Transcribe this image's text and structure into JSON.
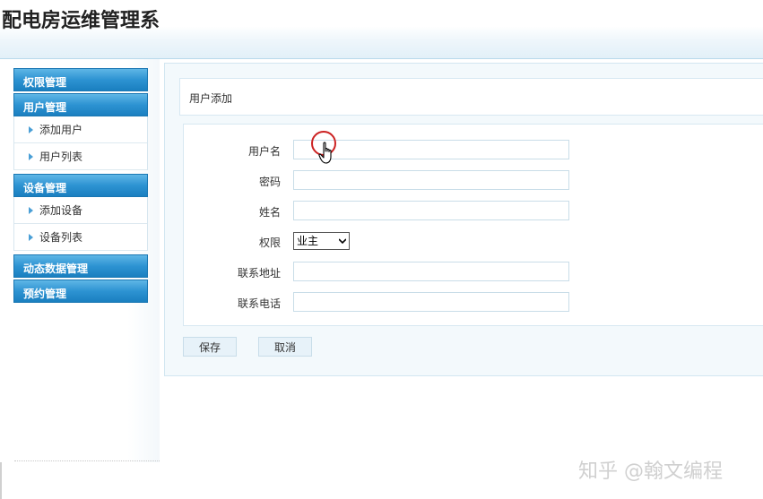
{
  "header": {
    "title": "配电房运维管理系"
  },
  "sidebar": {
    "groups": [
      {
        "label": "权限管理",
        "items": []
      },
      {
        "label": "用户管理",
        "items": [
          "添加用户",
          "用户列表"
        ]
      },
      {
        "label": "设备管理",
        "items": [
          "添加设备",
          "设备列表"
        ]
      },
      {
        "label": "动态数据管理",
        "items": []
      },
      {
        "label": "预约管理",
        "items": []
      }
    ]
  },
  "main": {
    "breadcrumb": "用户添加",
    "form": {
      "username_label": "用户名",
      "username_value": "",
      "password_label": "密码",
      "password_value": "",
      "name_label": "姓名",
      "name_value": "",
      "role_label": "权限",
      "role_selected": "业主",
      "address_label": "联系地址",
      "address_value": "",
      "phone_label": "联系电话",
      "phone_value": ""
    },
    "save_label": "保存",
    "cancel_label": "取消"
  },
  "watermark": "知乎 @翰文编程",
  "colors": {
    "menu_header": "#2d93d2",
    "cursor_ring": "#cc2222"
  }
}
